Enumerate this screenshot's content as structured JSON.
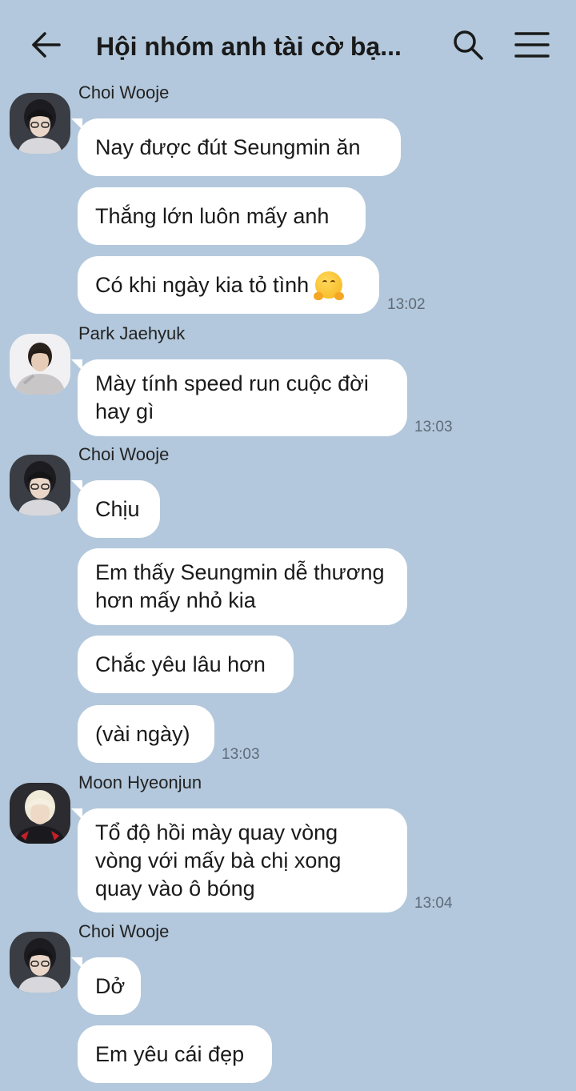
{
  "header": {
    "title": "Hội nhóm anh tài cờ bạ..."
  },
  "icons": {
    "back": "arrow-left-icon",
    "search": "search-icon",
    "menu": "hamburger-menu-icon"
  },
  "colors": {
    "background": "#b3c8dc",
    "bubble": "#ffffff",
    "timestamp": "#5f6b78"
  },
  "messages": [
    {
      "sender": "Choi Wooje",
      "bubbles": [
        "Nay được đút Seungmin ăn",
        "Thắng lớn luôn mấy anh",
        "Có khi ngày kia tỏ tình"
      ],
      "time": "13:02"
    },
    {
      "sender": "Park Jaehyuk",
      "bubbles": [
        "Mày tính speed run cuộc đời hay gì"
      ],
      "time": "13:03"
    },
    {
      "sender": "Choi Wooje",
      "bubbles": [
        "Chịu",
        "Em thấy Seungmin dễ thương hơn mấy nhỏ kia",
        "Chắc yêu lâu hơn",
        "(vài ngày)"
      ],
      "time": "13:03"
    },
    {
      "sender": "Moon Hyeonjun",
      "bubbles": [
        "Tổ độ hồi mày quay vòng vòng với mấy bà chị xong quay vào ô bóng"
      ],
      "time": "13:04"
    },
    {
      "sender": "Choi Wooje",
      "bubbles": [
        "Dở",
        "Em yêu cái đẹp"
      ]
    }
  ]
}
